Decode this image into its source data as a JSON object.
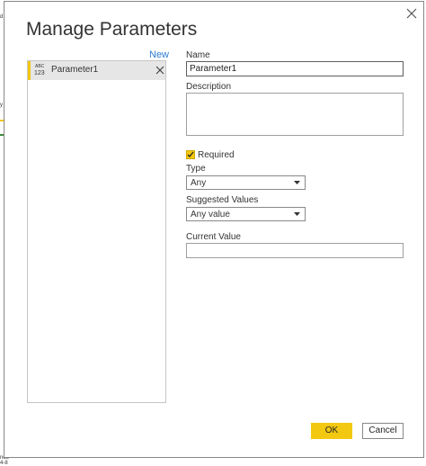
{
  "dialog": {
    "title": "Manage Parameters",
    "new_label": "New",
    "params": [
      {
        "type_top": "ABC",
        "type_bottom": "123",
        "label": "Parameter1"
      }
    ],
    "name_label": "Name",
    "name_value": "Parameter1",
    "description_label": "Description",
    "description_value": "",
    "required_label": "Required",
    "required_checked": true,
    "type_label": "Type",
    "type_value": "Any",
    "suggested_label": "Suggested Values",
    "suggested_value": "Any value",
    "current_label": "Current Value",
    "current_value": "",
    "ok_label": "OK",
    "cancel_label": "Cancel"
  },
  "colors": {
    "accent": "#f2c811",
    "link": "#2b7cd3",
    "border": "#8a8886"
  },
  "backdrop": {
    "edge_text_top": "d",
    "edge_text_mid": "y",
    "edge_text_bottom": "ndo 4-8"
  }
}
